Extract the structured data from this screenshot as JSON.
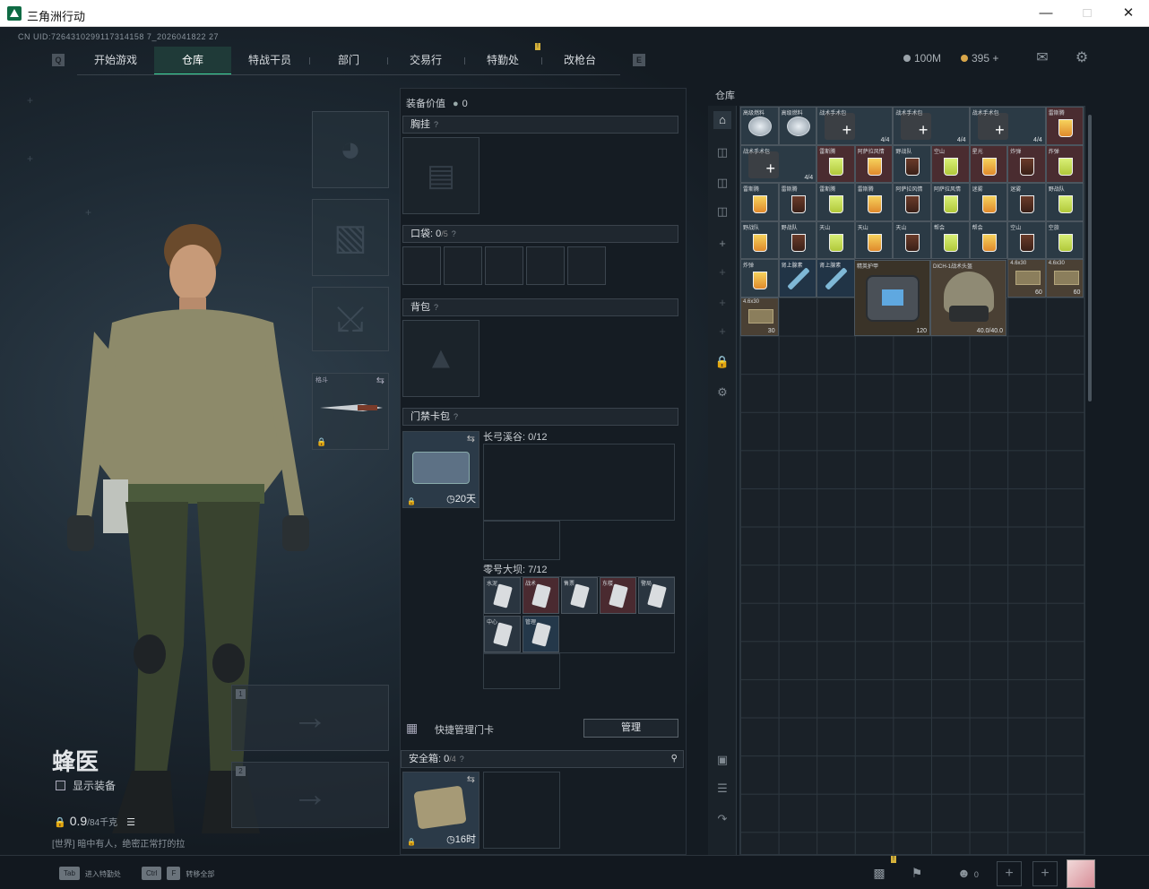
{
  "window": {
    "title": "三角洲行动"
  },
  "header": {
    "uid": "CN UID:7264310299117314158 7_2026041822 27",
    "tabs": [
      {
        "label": "开始游戏"
      },
      {
        "label": "仓库"
      },
      {
        "label": "特战干员"
      },
      {
        "label": "部门"
      },
      {
        "label": "交易行"
      },
      {
        "label": "特勤处"
      },
      {
        "label": "改枪台"
      }
    ],
    "left_key": "Q",
    "right_key": "E",
    "currency_a": "100M",
    "currency_b": "395 +"
  },
  "operator": {
    "name": "蜂医",
    "show_gear": "显示装备",
    "weight": "0.9",
    "weight_unit": "/84千克",
    "tip_tag": "[世界]",
    "tip_text": "[世界] 暗中有人，绝密正常打的拉"
  },
  "melee": {
    "label": "格斗"
  },
  "gear": {
    "value_label": "装备价值",
    "value": "0",
    "chest_label": "胸挂",
    "pocket_label": "口袋:",
    "pocket_value": "0",
    "pocket_max": "/5",
    "backpack_label": "背包",
    "keycard_label": "门禁卡包",
    "keycard_time": "20天",
    "map1_label": "长弓溪谷: 0/12",
    "map2_label": "零号大坝: 7/12",
    "quick_manage": "快捷管理门卡",
    "manage_btn": "管理",
    "safe_label": "安全箱:",
    "safe_value": "0",
    "safe_max": "/4",
    "safe_time": "16时"
  },
  "keycards": [
    {
      "name": "水泥",
      "tone": ""
    },
    {
      "name": "战术",
      "tone": "red"
    },
    {
      "name": "售票",
      "tone": ""
    },
    {
      "name": "东楼",
      "tone": "red"
    },
    {
      "name": "警局",
      "tone": ""
    },
    {
      "name": "中心",
      "tone": ""
    },
    {
      "name": "管理",
      "tone": "blue"
    }
  ],
  "stash": {
    "title": "仓库",
    "items": [
      {
        "name": "高级燃料",
        "count": "",
        "kind": "tin",
        "tone": ""
      },
      {
        "name": "高级燃料",
        "count": "",
        "kind": "tin",
        "tone": ""
      },
      {
        "name": "战术手术包",
        "count": "4/4",
        "kind": "medkit",
        "tone": ""
      },
      {
        "name": "战术手术包",
        "count": "4/4",
        "kind": "medkit",
        "tone": ""
      },
      {
        "name": "战术手术包",
        "count": "4/4",
        "kind": "medkit",
        "tone": ""
      },
      {
        "name": "雷斯腾",
        "count": "",
        "kind": "drink",
        "tone": "red"
      },
      {
        "name": "战术手术包",
        "count": "4/4",
        "kind": "medkit",
        "tone": ""
      },
      {
        "name": "雷斯腾",
        "count": "",
        "kind": "drink",
        "tone": "red"
      },
      {
        "name": "阿萨拉风情",
        "count": "",
        "kind": "drink",
        "tone": "red"
      },
      {
        "name": "野战队",
        "count": "",
        "kind": "drink",
        "tone": ""
      },
      {
        "name": "空山",
        "count": "",
        "kind": "drink",
        "tone": "red"
      },
      {
        "name": "星光",
        "count": "",
        "kind": "drink",
        "tone": "red"
      },
      {
        "name": "炸弹",
        "count": "",
        "kind": "drink",
        "tone": "red"
      },
      {
        "name": "炸弹",
        "count": "",
        "kind": "drink",
        "tone": "red"
      },
      {
        "name": "雷斯腾",
        "count": "",
        "kind": "drink",
        "tone": ""
      },
      {
        "name": "雷斯腾",
        "count": "",
        "kind": "drink",
        "tone": ""
      },
      {
        "name": "雷斯腾",
        "count": "",
        "kind": "drink",
        "tone": ""
      },
      {
        "name": "雷斯腾",
        "count": "",
        "kind": "drink",
        "tone": ""
      },
      {
        "name": "阿萨拉风情",
        "count": "",
        "kind": "drink",
        "tone": ""
      },
      {
        "name": "阿萨拉风情",
        "count": "",
        "kind": "drink",
        "tone": ""
      },
      {
        "name": "迷雾",
        "count": "",
        "kind": "drink",
        "tone": ""
      },
      {
        "name": "迷雾",
        "count": "",
        "kind": "drink",
        "tone": ""
      },
      {
        "name": "野战队",
        "count": "",
        "kind": "drink",
        "tone": ""
      },
      {
        "name": "野战队",
        "count": "",
        "kind": "drink",
        "tone": ""
      },
      {
        "name": "野战队",
        "count": "",
        "kind": "drink",
        "tone": ""
      },
      {
        "name": "天山",
        "count": "",
        "kind": "drink",
        "tone": ""
      },
      {
        "name": "天山",
        "count": "",
        "kind": "drink",
        "tone": ""
      },
      {
        "name": "天山",
        "count": "",
        "kind": "drink",
        "tone": ""
      },
      {
        "name": "帮会",
        "count": "",
        "kind": "drink",
        "tone": ""
      },
      {
        "name": "帮会",
        "count": "",
        "kind": "drink",
        "tone": ""
      },
      {
        "name": "空山",
        "count": "",
        "kind": "drink",
        "tone": ""
      },
      {
        "name": "空旅",
        "count": "",
        "kind": "drink",
        "tone": ""
      },
      {
        "name": "炸弹",
        "count": "",
        "kind": "drink",
        "tone": ""
      },
      {
        "name": "肾上腺素",
        "count": "",
        "kind": "syringe",
        "tone": "blue"
      },
      {
        "name": "肾上腺素",
        "count": "",
        "kind": "syringe",
        "tone": "blue"
      },
      {
        "name": "4.6x30",
        "count": "60",
        "kind": "ammo",
        "tone": "brown"
      },
      {
        "name": "4.6x30",
        "count": "60",
        "kind": "ammo",
        "tone": "brown"
      },
      {
        "name": "4.6x30",
        "count": "30",
        "kind": "ammo",
        "tone": "brown"
      }
    ],
    "vest": {
      "name": "精英护甲",
      "count": "120"
    },
    "helmet": {
      "name": "DICH-1战术头盔",
      "count": "40.0/40.0"
    }
  },
  "bottom": {
    "key1": "Tab",
    "hint1": "进入特勤处",
    "key2": "Ctrl",
    "key3": "F",
    "hint2": "转移全部",
    "friends": "0"
  }
}
